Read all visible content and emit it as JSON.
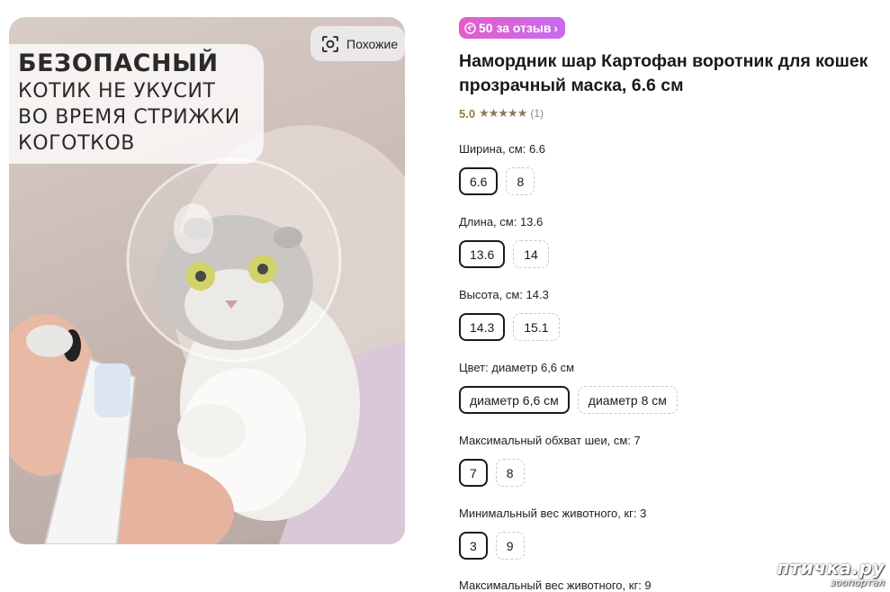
{
  "image": {
    "promo_line1": "БЕЗОПАСНЫЙ",
    "promo_line2": "КОТИК НЕ УКУСИТ",
    "promo_line3": "ВО ВРЕМЯ СТРИЖКИ",
    "promo_line4": "КОГОТКОВ",
    "similar_label": "Похожие"
  },
  "badge": {
    "label": "50 за отзыв",
    "icon": "coin-icon",
    "color": "#d96ad0"
  },
  "product": {
    "title": "Намордник шар Картофан воротник для кошек прозрачный маска, 6.6 см",
    "rating": "5.0",
    "stars": "★★★★★",
    "reviews": "(1)"
  },
  "params": [
    {
      "label": "Ширина, см: ",
      "value": "6.6",
      "options": [
        "6.6",
        "8"
      ],
      "selected": 0
    },
    {
      "label": "Длина, см: ",
      "value": "13.6",
      "options": [
        "13.6",
        "14"
      ],
      "selected": 0
    },
    {
      "label": "Высота, см: ",
      "value": "14.3",
      "options": [
        "14.3",
        "15.1"
      ],
      "selected": 0
    },
    {
      "label": "Цвет: ",
      "value": "диаметр 6,6 см",
      "options": [
        "диаметр 6,6 см",
        "диаметр 8 см"
      ],
      "selected": 0
    },
    {
      "label": "Максимальный обхват шеи, см: ",
      "value": "7",
      "options": [
        "7",
        "8"
      ],
      "selected": 0
    },
    {
      "label": "Минимальный вес животного, кг: ",
      "value": "3",
      "options": [
        "3",
        "9"
      ],
      "selected": 0
    },
    {
      "label": "Максимальный вес животного, кг: ",
      "value": "9"
    }
  ],
  "watermark": {
    "line1": "птичка.ру",
    "line2": "зоопортал"
  }
}
